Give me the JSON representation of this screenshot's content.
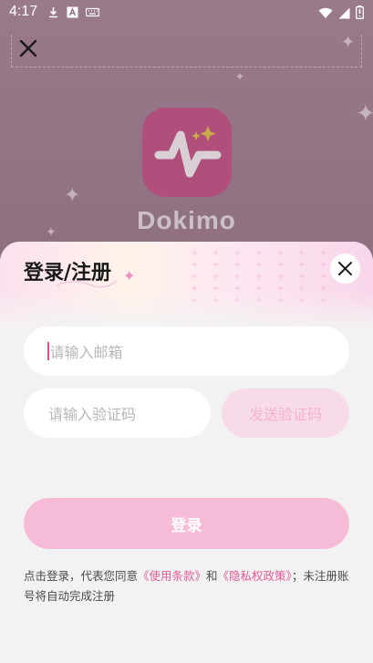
{
  "status_bar": {
    "time": "4:17"
  },
  "background_app": {
    "logo_text": "Dokimo"
  },
  "sheet": {
    "title": "登录/注册",
    "email_placeholder": "请输入邮箱",
    "code_placeholder": "请输入验证码",
    "send_code_label": "发送验证码",
    "login_label": "登录",
    "agreement": {
      "prefix": "点击登录，代表您同意",
      "terms_link": "《使用条款》",
      "and": "和",
      "privacy_link": "《隐私权政策》",
      "suffix": "；未注册账号将自动完成注册"
    }
  },
  "colors": {
    "accent": "#e05b98",
    "login_button": "#f6bcd7",
    "send_code_bg": "#f7dbe8",
    "app_icon": "#b04e7c"
  },
  "icons": [
    "download-icon",
    "a-badge-icon",
    "keyboard-icon",
    "wifi-icon",
    "signal-icon",
    "battery-icon",
    "close-icon",
    "sparkle-icon"
  ]
}
